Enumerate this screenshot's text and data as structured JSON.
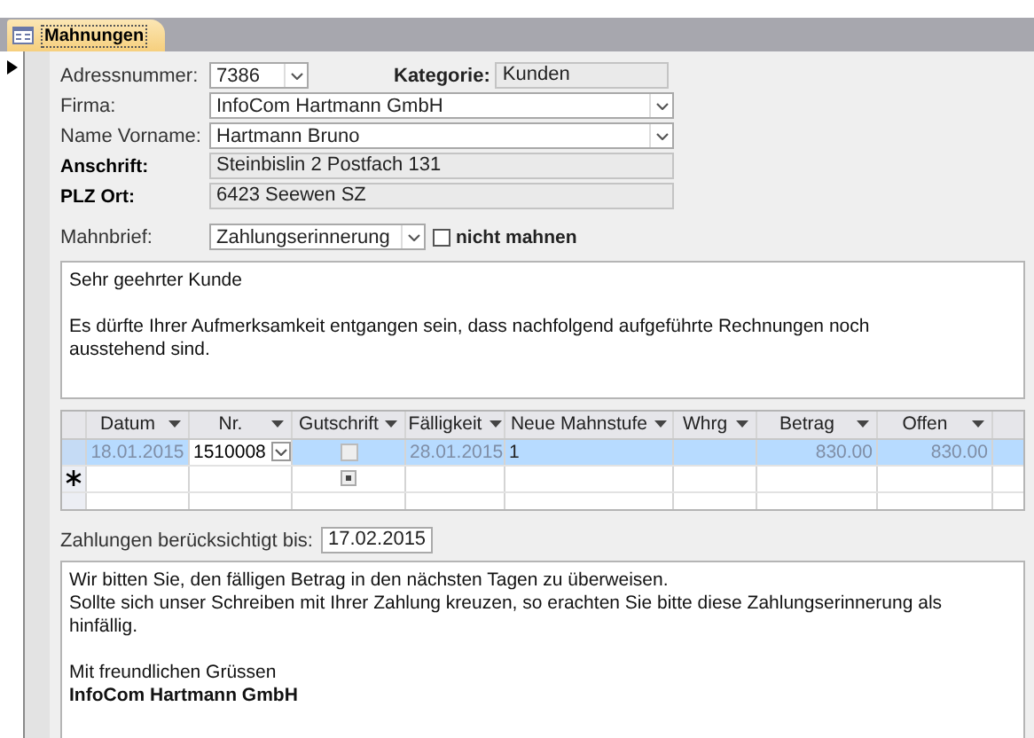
{
  "tab": {
    "label": "Mahnungen",
    "selected": true
  },
  "address_number": {
    "label": "Adressnummer:",
    "value": "7386"
  },
  "category": {
    "label": "Kategorie:",
    "value": "Kunden"
  },
  "fields": [
    {
      "label": "Firma:",
      "value": "InfoCom Hartmann GmbH",
      "kind": "combo"
    },
    {
      "label": "Name Vorname:",
      "value": "Hartmann Bruno",
      "kind": "combo"
    },
    {
      "label": "Anschrift:",
      "value": "Steinbislin 2 Postfach 131",
      "kind": "readonly"
    },
    {
      "label": "PLZ Ort:",
      "value": "6423 Seewen SZ",
      "kind": "readonly"
    }
  ],
  "letter_type": {
    "label": "Mahnbrief:",
    "value": "Zahlungserinnerung"
  },
  "no_reminder": {
    "label": "nicht mahnen",
    "checked": false
  },
  "intro_text": [
    "Sehr geehrter Kunde",
    "Es dürfte Ihrer Aufmerksamkeit entgangen sein, dass nachfolgend aufgeführte Rechnungen noch\nausstehend sind."
  ],
  "table": {
    "columns": [
      {
        "label": "Datum"
      },
      {
        "label": "Nr."
      },
      {
        "label": "Gutschrift"
      },
      {
        "label": "Fälligkeit"
      },
      {
        "label": "Neue Mahnstufe"
      },
      {
        "label": "Whrg"
      },
      {
        "label": "Betrag"
      },
      {
        "label": "Offen"
      }
    ],
    "rows": [
      {
        "selected": true,
        "date": "18.01.2015",
        "number": "1510008",
        "credit": false,
        "due": "28.01.2015",
        "new_level": "1",
        "amount": "830.00",
        "open": "830.00"
      }
    ]
  },
  "paid_until": {
    "label": "Zahlungen berücksichtigt bis:",
    "value": "17.02.2015"
  },
  "closing_text": [
    "Wir bitten Sie, den fälligen Betrag in den nächsten Tagen zu überweisen.\nSollte sich unser Schreiben mit Ihrer Zahlung kreuzen, so erachten Sie bitte diese Zahlungserinnerung als\nhinfällig.",
    "Mit freundlichen Grüssen\n**InfoCom Hartmann GmbH**"
  ]
}
